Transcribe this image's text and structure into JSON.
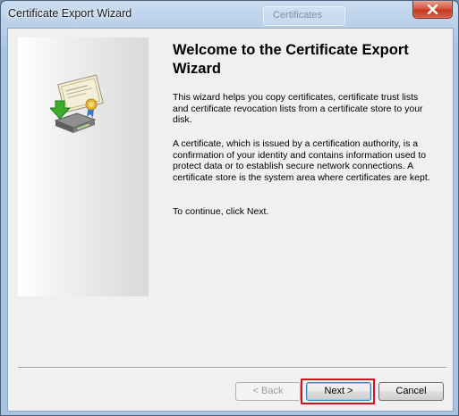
{
  "window": {
    "title": "Certificate Export Wizard",
    "background_tab_label": "Certificates",
    "close_icon": "close-icon"
  },
  "side_panel": {
    "graphic_icon": "certificate-export-icon"
  },
  "content": {
    "heading": "Welcome to the Certificate Export Wizard",
    "paragraphs": [
      "This wizard helps you copy certificates, certificate trust lists and certificate revocation lists from a certificate store to your disk.",
      "A certificate, which is issued by a certification authority, is a confirmation of your identity and contains information used to protect data or to establish secure network connections. A certificate store is the system area where certificates are kept.",
      "To continue, click Next."
    ]
  },
  "buttons": {
    "back_label": "< Back",
    "back_enabled": false,
    "next_label": "Next >",
    "next_highlighted": true,
    "cancel_label": "Cancel"
  },
  "colors": {
    "highlight": "#d8101c",
    "client_background": "#f0f0f0"
  }
}
